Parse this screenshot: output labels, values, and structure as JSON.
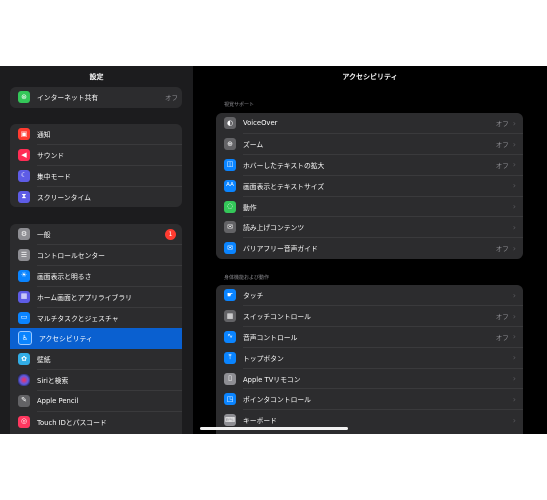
{
  "sidebar": {
    "title": "設定",
    "groups": [
      {
        "items": [
          {
            "label": "インターネット共有",
            "value": "オフ",
            "icon": "hotspot-icon",
            "color": "#34c759",
            "glyph": "⊛"
          }
        ]
      },
      {
        "items": [
          {
            "label": "通知",
            "icon": "notification-icon",
            "color": "#ff3b30",
            "glyph": "▣"
          },
          {
            "label": "サウンド",
            "icon": "speaker-icon",
            "color": "#ff2d55",
            "glyph": "◀"
          },
          {
            "label": "集中モード",
            "icon": "moon-icon",
            "color": "#5e5ce6",
            "glyph": "☾"
          },
          {
            "label": "スクリーンタイム",
            "icon": "hourglass-icon",
            "color": "#5e5ce6",
            "glyph": "⧗"
          }
        ]
      },
      {
        "items": [
          {
            "label": "一般",
            "badge": "1",
            "icon": "gear-icon",
            "color": "#8e8e93",
            "glyph": "⚙"
          },
          {
            "label": "コントロールセンター",
            "icon": "control-center-icon",
            "color": "#8e8e93",
            "glyph": "☰"
          },
          {
            "label": "画面表示と明るさ",
            "icon": "brightness-icon",
            "color": "#0a84ff",
            "glyph": "☀"
          },
          {
            "label": "ホーム画面とアプリライブラリ",
            "icon": "home-screen-icon",
            "color": "#5e5ce6",
            "glyph": "▦"
          },
          {
            "label": "マルチタスクとジェスチャ",
            "icon": "multitasking-icon",
            "color": "#0a84ff",
            "glyph": "▭"
          },
          {
            "label": "アクセシビリティ",
            "icon": "accessibility-icon",
            "color": "#0a84ff",
            "glyph": "♿",
            "selected": true
          },
          {
            "label": "壁紙",
            "icon": "wallpaper-icon",
            "color": "#32ade6",
            "glyph": "✿"
          },
          {
            "label": "Siriと検索",
            "icon": "siri-icon",
            "color": "#1c1c1e",
            "glyph": "◉"
          },
          {
            "label": "Apple Pencil",
            "icon": "pencil-icon",
            "color": "#636366",
            "glyph": "✎"
          },
          {
            "label": "Touch IDとパスコード",
            "icon": "fingerprint-icon",
            "color": "#ff375f",
            "glyph": "◎"
          }
        ]
      }
    ]
  },
  "detail": {
    "title": "アクセシビリティ",
    "sections": [
      {
        "header": "視覚サポート",
        "items": [
          {
            "label": "VoiceOver",
            "value": "オフ",
            "icon": "voiceover-icon",
            "color": "#636366",
            "glyph": "◐"
          },
          {
            "label": "ズーム",
            "value": "オフ",
            "icon": "zoom-icon",
            "color": "#636366",
            "glyph": "⊕"
          },
          {
            "label": "ホバーしたテキストの拡大",
            "value": "オフ",
            "icon": "hover-text-icon",
            "color": "#0a84ff",
            "glyph": "◫"
          },
          {
            "label": "画面表示とテキストサイズ",
            "icon": "text-size-icon",
            "color": "#0a84ff",
            "glyph": "AA"
          },
          {
            "label": "動作",
            "icon": "motion-icon",
            "color": "#34c759",
            "glyph": "◌"
          },
          {
            "label": "読み上げコンテンツ",
            "icon": "spoken-content-icon",
            "color": "#636366",
            "glyph": "✉"
          },
          {
            "label": "バリアフリー音声ガイド",
            "value": "オフ",
            "icon": "audio-description-icon",
            "color": "#0a84ff",
            "glyph": "✉"
          }
        ]
      },
      {
        "header": "身体機能および動作",
        "items": [
          {
            "label": "タッチ",
            "icon": "touch-icon",
            "color": "#0a84ff",
            "glyph": "☛"
          },
          {
            "label": "スイッチコントロール",
            "value": "オフ",
            "icon": "switch-control-icon",
            "color": "#636366",
            "glyph": "▦"
          },
          {
            "label": "音声コントロール",
            "value": "オフ",
            "icon": "voice-control-icon",
            "color": "#0a84ff",
            "glyph": "∿"
          },
          {
            "label": "トップボタン",
            "icon": "top-button-icon",
            "color": "#0a84ff",
            "glyph": "⤒"
          },
          {
            "label": "Apple TVリモコン",
            "icon": "remote-icon",
            "color": "#8e8e93",
            "glyph": "▯"
          },
          {
            "label": "ポインタコントロール",
            "icon": "pointer-icon",
            "color": "#0a84ff",
            "glyph": "◳"
          },
          {
            "label": "キーボード",
            "icon": "keyboard-icon",
            "color": "#8e8e93",
            "glyph": "⌨"
          }
        ]
      }
    ]
  }
}
